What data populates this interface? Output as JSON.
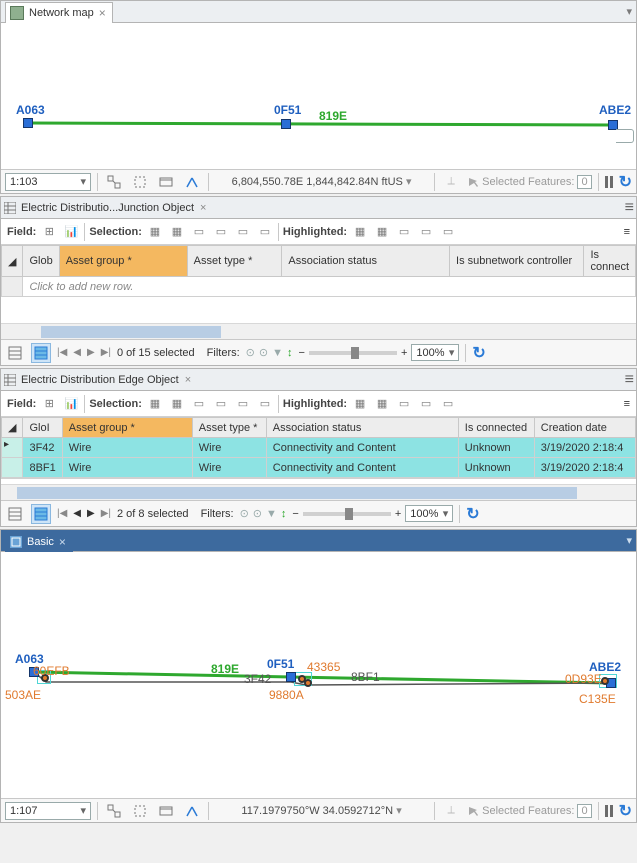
{
  "map1": {
    "tab": "Network map",
    "scale": "1:103",
    "coord": "6,804,550.78E 1,844,842.84N ftUS",
    "selected_label": "Selected Features:",
    "selected_count": "0",
    "nodes": {
      "A063": "A063",
      "0F51": "0F51",
      "ABE2": "ABE2",
      "819E": "819E"
    }
  },
  "table1": {
    "tab": "Electric Distributio...Junction Object",
    "field_lbl": "Field:",
    "selection_lbl": "Selection:",
    "highlighted_lbl": "Highlighted:",
    "cols": {
      "glob": "Glob",
      "assetgroup": "Asset group *",
      "assettype": "Asset type *",
      "assoc": "Association status",
      "subnet": "Is subnetwork controller",
      "isconn": "Is connect"
    },
    "newrow": "Click to add new row.",
    "selcount": "0 of 15 selected",
    "filters_lbl": "Filters:",
    "zoom": "100%"
  },
  "table2": {
    "tab": "Electric Distribution Edge Object",
    "field_lbl": "Field:",
    "selection_lbl": "Selection:",
    "highlighted_lbl": "Highlighted:",
    "cols": {
      "glob": "GloI",
      "assetgroup": "Asset group *",
      "assettype": "Asset type *",
      "assoc": "Association status",
      "isconn": "Is connected",
      "cdate": "Creation date"
    },
    "rows": [
      {
        "glob": "3F42",
        "assetgroup": "Wire",
        "assettype": "Wire",
        "assoc": "Connectivity and Content",
        "isconn": "Unknown",
        "cdate": "3/19/2020 2:18:4"
      },
      {
        "glob": "8BF1",
        "assetgroup": "Wire",
        "assettype": "Wire",
        "assoc": "Connectivity and Content",
        "isconn": "Unknown",
        "cdate": "3/19/2020 2:18:4"
      }
    ],
    "selcount": "2 of 8 selected",
    "filters_lbl": "Filters:",
    "zoom": "100%"
  },
  "map2": {
    "tab": "Basic",
    "scale": "1:107",
    "coord": "117.1979750°W 34.0592712°N",
    "selected_label": "Selected Features:",
    "selected_count": "0",
    "labels": {
      "A063": "A063",
      "0F51": "0F51",
      "ABE2": "ABE2",
      "819E": "819E",
      "3F42": "3F42",
      "8BF1": "8BF1",
      "43365": "43365",
      "60EFB": "60EFB",
      "503AE": "503AE",
      "9880A": "9880A",
      "0D93E": "0D93E",
      "C135E": "C135E"
    }
  }
}
